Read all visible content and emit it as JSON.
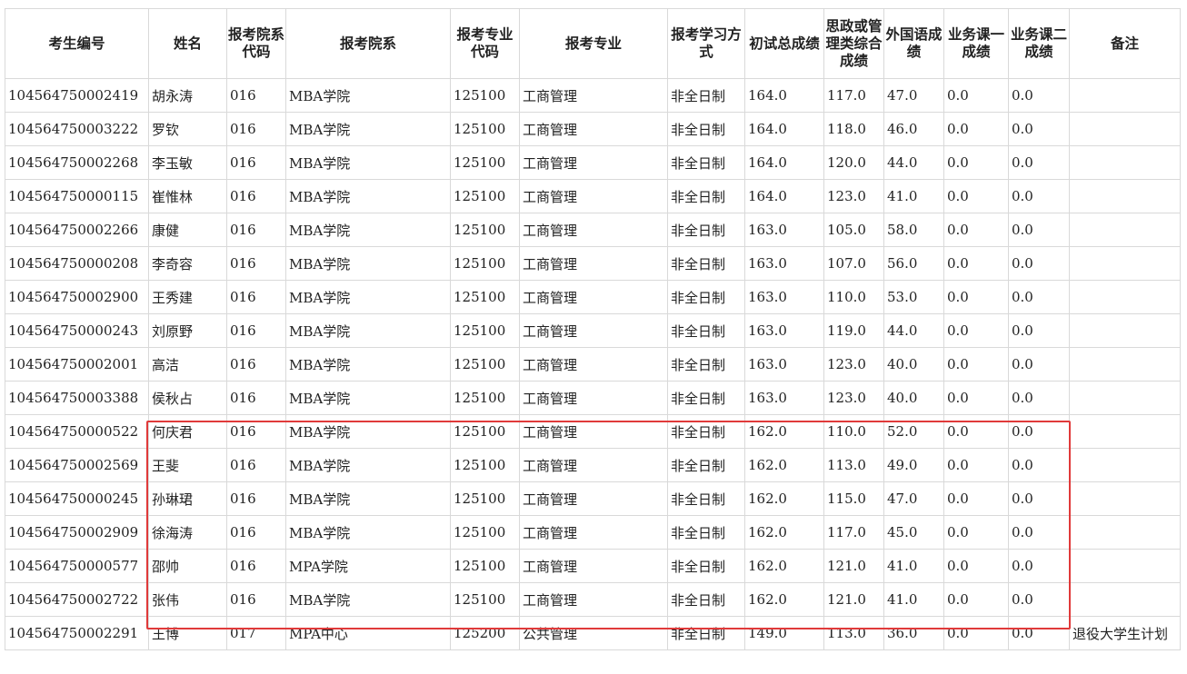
{
  "headers": [
    "考生编号",
    "姓名",
    "报考院系代码",
    "报考院系",
    "报考专业代码",
    "报考专业",
    "报考学习方式",
    "初试总成绩",
    "思政或管理类综合成绩",
    "外国语成绩",
    "业务课一成绩",
    "业务课二成绩",
    "备注"
  ],
  "rows": [
    [
      "104564750002419",
      "胡永涛",
      "016",
      "MBA学院",
      "125100",
      "工商管理",
      "非全日制",
      "164.0",
      "117.0",
      "47.0",
      "0.0",
      "0.0",
      ""
    ],
    [
      "104564750003222",
      "罗钦",
      "016",
      "MBA学院",
      "125100",
      "工商管理",
      "非全日制",
      "164.0",
      "118.0",
      "46.0",
      "0.0",
      "0.0",
      ""
    ],
    [
      "104564750002268",
      "李玉敏",
      "016",
      "MBA学院",
      "125100",
      "工商管理",
      "非全日制",
      "164.0",
      "120.0",
      "44.0",
      "0.0",
      "0.0",
      ""
    ],
    [
      "104564750000115",
      "崔惟林",
      "016",
      "MBA学院",
      "125100",
      "工商管理",
      "非全日制",
      "164.0",
      "123.0",
      "41.0",
      "0.0",
      "0.0",
      ""
    ],
    [
      "104564750002266",
      "康健",
      "016",
      "MBA学院",
      "125100",
      "工商管理",
      "非全日制",
      "163.0",
      "105.0",
      "58.0",
      "0.0",
      "0.0",
      ""
    ],
    [
      "104564750000208",
      "李奇容",
      "016",
      "MBA学院",
      "125100",
      "工商管理",
      "非全日制",
      "163.0",
      "107.0",
      "56.0",
      "0.0",
      "0.0",
      ""
    ],
    [
      "104564750002900",
      "王秀建",
      "016",
      "MBA学院",
      "125100",
      "工商管理",
      "非全日制",
      "163.0",
      "110.0",
      "53.0",
      "0.0",
      "0.0",
      ""
    ],
    [
      "104564750000243",
      "刘原野",
      "016",
      "MBA学院",
      "125100",
      "工商管理",
      "非全日制",
      "163.0",
      "119.0",
      "44.0",
      "0.0",
      "0.0",
      ""
    ],
    [
      "104564750002001",
      "高洁",
      "016",
      "MBA学院",
      "125100",
      "工商管理",
      "非全日制",
      "163.0",
      "123.0",
      "40.0",
      "0.0",
      "0.0",
      ""
    ],
    [
      "104564750003388",
      "侯秋占",
      "016",
      "MBA学院",
      "125100",
      "工商管理",
      "非全日制",
      "163.0",
      "123.0",
      "40.0",
      "0.0",
      "0.0",
      ""
    ],
    [
      "104564750000522",
      "何庆君",
      "016",
      "MBA学院",
      "125100",
      "工商管理",
      "非全日制",
      "162.0",
      "110.0",
      "52.0",
      "0.0",
      "0.0",
      ""
    ],
    [
      "104564750002569",
      "王斐",
      "016",
      "MBA学院",
      "125100",
      "工商管理",
      "非全日制",
      "162.0",
      "113.0",
      "49.0",
      "0.0",
      "0.0",
      ""
    ],
    [
      "104564750000245",
      "孙琳珺",
      "016",
      "MBA学院",
      "125100",
      "工商管理",
      "非全日制",
      "162.0",
      "115.0",
      "47.0",
      "0.0",
      "0.0",
      ""
    ],
    [
      "104564750002909",
      "徐海涛",
      "016",
      "MBA学院",
      "125100",
      "工商管理",
      "非全日制",
      "162.0",
      "117.0",
      "45.0",
      "0.0",
      "0.0",
      ""
    ],
    [
      "104564750000577",
      "邵帅",
      "016",
      "MPA学院",
      "125100",
      "工商管理",
      "非全日制",
      "162.0",
      "121.0",
      "41.0",
      "0.0",
      "0.0",
      ""
    ],
    [
      "104564750002722",
      "张伟",
      "016",
      "MBA学院",
      "125100",
      "工商管理",
      "非全日制",
      "162.0",
      "121.0",
      "41.0",
      "0.0",
      "0.0",
      ""
    ],
    [
      "104564750002291",
      "王博",
      "017",
      "MPA中心",
      "125200",
      "公共管理",
      "非全日制",
      "149.0",
      "113.0",
      "36.0",
      "0.0",
      "0.0",
      "退役大学生计划"
    ]
  ],
  "highlight_color": "#e03a3a"
}
